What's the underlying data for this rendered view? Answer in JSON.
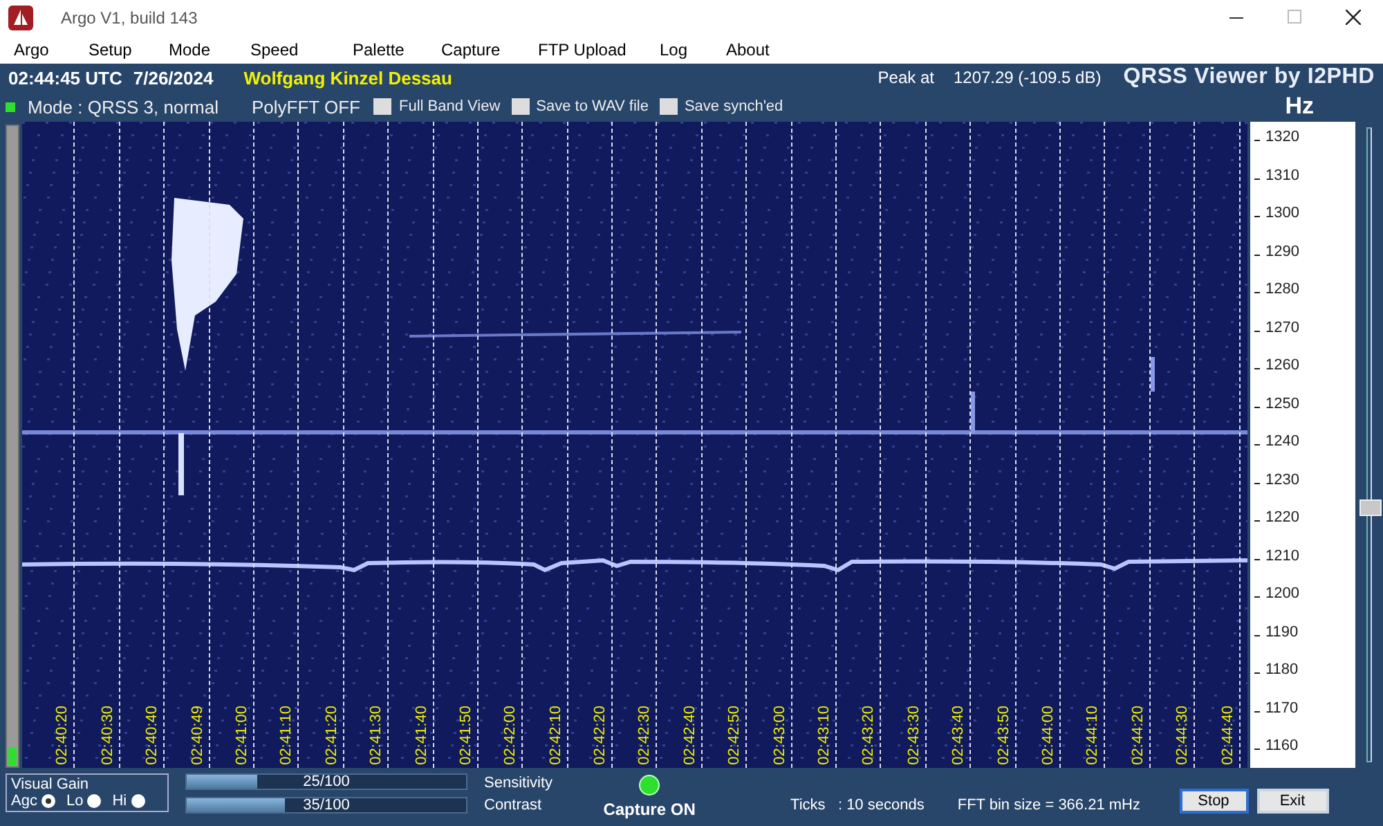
{
  "window": {
    "title": "Argo V1, build 143"
  },
  "menu": [
    "Argo",
    "Setup",
    "Mode",
    "Speed",
    "Palette",
    "Capture",
    "FTP Upload",
    "Log",
    "About"
  ],
  "header": {
    "time": "02:44:45 UTC",
    "date": "7/26/2024",
    "station": "Wolfgang Kinzel Dessau",
    "peak_label": "Peak at",
    "peak_value": "1207.29 (-109.5 dB)",
    "brand": "QRSS Viewer by I2PHD"
  },
  "mode_row": {
    "mode": "Mode : QRSS 3, normal",
    "polyfft": "PolyFFT OFF",
    "unit": "Hz",
    "options": [
      {
        "label": "Full Band View",
        "checked": false
      },
      {
        "label": "Save to WAV file",
        "checked": false
      },
      {
        "label": "Save synch'ed",
        "checked": false
      }
    ]
  },
  "time_ticks": [
    "02:40:20",
    "02:40:30",
    "02:40:40",
    "02:40:49",
    "02:41:00",
    "02:41:10",
    "02:41:20",
    "02:41:30",
    "02:41:40",
    "02:41:50",
    "02:42:00",
    "02:42:10",
    "02:42:20",
    "02:42:30",
    "02:42:40",
    "02:42:50",
    "02:43:00",
    "02:43:10",
    "02:43:20",
    "02:43:30",
    "02:43:40",
    "02:43:50",
    "02:44:00",
    "02:44:10",
    "02:44:20",
    "02:44:30",
    "02:44:40"
  ],
  "frequency_scale": [
    "1320",
    "1310",
    "1300",
    "1290",
    "1280",
    "1270",
    "1260",
    "1250",
    "1240",
    "1230",
    "1220",
    "1210",
    "1200",
    "1190",
    "1180",
    "1170",
    "1160"
  ],
  "frequency_slider": {
    "level": 0.4
  },
  "visual_gain": {
    "title": "Visual Gain",
    "options": [
      {
        "label": "Agc",
        "selected": true
      },
      {
        "label": "Lo",
        "selected": false
      },
      {
        "label": "Hi",
        "selected": false
      }
    ]
  },
  "sliders": [
    {
      "reading": "25/100",
      "level": 0.25,
      "label": "Sensitivity"
    },
    {
      "reading": "35/100",
      "level": 0.35,
      "label": "Contrast"
    }
  ],
  "capture": {
    "label": "Capture ON",
    "on": true
  },
  "ticks": "Ticks   : 10 seconds",
  "fft_bin": "FFT bin size = 366.21 mHz",
  "buttons": [
    "Stop",
    "Exit"
  ]
}
